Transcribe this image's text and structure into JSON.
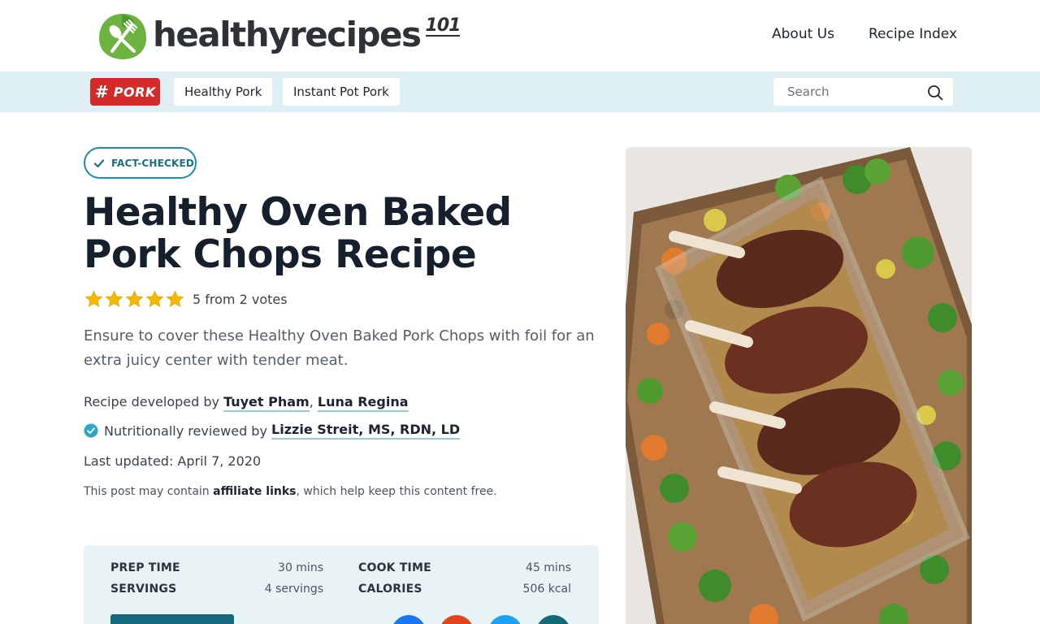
{
  "header": {
    "logo_text": "healthyrecipes",
    "logo_sup": "101",
    "nav": [
      "About Us",
      "Recipe Index"
    ]
  },
  "tagbar": {
    "badge_hash": "#",
    "badge_word": "PORK",
    "chips": [
      "Healthy Pork",
      "Instant Pot Pork"
    ],
    "search_placeholder": "Search"
  },
  "article": {
    "fact_checked": "FACT-CHECKED",
    "title": "Healthy Oven Baked Pork Chops Recipe",
    "rating": {
      "stars": 5,
      "text": "5 from 2 votes"
    },
    "description": "Ensure to cover these Healthy Oven Baked Pork Chops with foil for an extra juicy center with tender meat.",
    "byline_prefix": "Recipe developed by ",
    "authors": [
      "Tuyet Pham",
      "Luna Regina"
    ],
    "reviewed_prefix": "Nutritionally reviewed by ",
    "reviewer": "Lizzie Streit, MS, RDN, LD",
    "updated_label": "Last updated: ",
    "updated_date": "April 7, 2020",
    "affiliate_pre": "This post may contain ",
    "affiliate_link": "affiliate links",
    "affiliate_post": ", which help keep this content free."
  },
  "meta": {
    "prep_label": "PREP TIME",
    "prep_value": "30 mins",
    "cook_label": "COOK TIME",
    "cook_value": "45 mins",
    "servings_label": "SERVINGS",
    "servings_value": "4 servings",
    "calories_label": "CALORIES",
    "calories_value": "506 kcal"
  },
  "colors": {
    "accent": "#1a8fa6",
    "tagbar_bg": "#dff0f4",
    "pork_red": "#d32a2a",
    "logo_green": "#6cb33f"
  }
}
